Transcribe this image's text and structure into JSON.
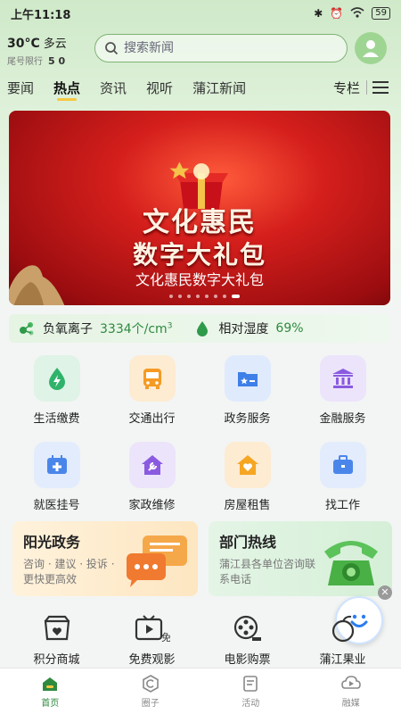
{
  "status_bar": {
    "time": "上午11:18",
    "battery": "59"
  },
  "weather": {
    "temperature": "30°C",
    "condition": "多云",
    "plate_label": "尾号限行",
    "plate_numbers": "5 0"
  },
  "search": {
    "placeholder": "搜索新闻"
  },
  "tabs": [
    {
      "label": "要闻",
      "active": false
    },
    {
      "label": "热点",
      "active": true
    },
    {
      "label": "资讯",
      "active": false
    },
    {
      "label": "视听",
      "active": false
    },
    {
      "label": "蒲江新闻",
      "active": false
    }
  ],
  "tab_more": "专栏",
  "banner": {
    "headline_line1": "文化惠民",
    "headline_line2": "数字大礼包",
    "caption": "文化惠民数字大礼包",
    "slide_count": 8,
    "active_slide": 8
  },
  "environment": {
    "ion_label": "负氧离子",
    "ion_value": "3334个/cm",
    "ion_unit_sup": "3",
    "humidity_label": "相对湿度",
    "humidity_value": "69%"
  },
  "services": [
    {
      "label": "生活缴费",
      "icon": "water-drop-bolt-icon",
      "bg": "#dff3e6",
      "color": "#2fb36a"
    },
    {
      "label": "交通出行",
      "icon": "bus-icon",
      "bg": "#fdebd2",
      "color": "#f59a23"
    },
    {
      "label": "政务服务",
      "icon": "folder-star-icon",
      "bg": "#dfeafd",
      "color": "#3f7fe8"
    },
    {
      "label": "金融服务",
      "icon": "bank-icon",
      "bg": "#ece4fb",
      "color": "#8a5be0"
    },
    {
      "label": "就医挂号",
      "icon": "medical-calendar-icon",
      "bg": "#e2ecfc",
      "color": "#4a86ea"
    },
    {
      "label": "家政维修",
      "icon": "house-wrench-icon",
      "bg": "#ece4fb",
      "color": "#8a5be0"
    },
    {
      "label": "房屋租售",
      "icon": "house-heart-icon",
      "bg": "#fdebd2",
      "color": "#f5a623"
    },
    {
      "label": "找工作",
      "icon": "briefcase-icon",
      "bg": "#e2ecfc",
      "color": "#4a86ea"
    }
  ],
  "cards": [
    {
      "title": "阳光政务",
      "subtitle": "咨询 · 建议 · 投诉 · 更快更高效"
    },
    {
      "title": "部门热线",
      "subtitle": "蒲江县各单位咨询联系电话"
    }
  ],
  "services2": [
    {
      "label": "积分商城",
      "icon": "shop-heart-icon"
    },
    {
      "label": "免费观影",
      "icon": "tv-play-icon"
    },
    {
      "label": "电影购票",
      "icon": "film-reel-icon"
    },
    {
      "label": "蒲江果业",
      "icon": "fruit-icon"
    }
  ],
  "bottom_nav": [
    {
      "label": "首页",
      "icon": "home-icon",
      "active": true
    },
    {
      "label": "圈子",
      "icon": "circle-c-icon",
      "active": false
    },
    {
      "label": "活动",
      "icon": "activity-doc-icon",
      "active": false
    },
    {
      "label": "融媒",
      "icon": "media-play-icon",
      "active": false
    }
  ],
  "colors": {
    "accent": "#2e8a3f",
    "tab_indicator": "#f6c842",
    "banner_red": "#d51f1c"
  }
}
